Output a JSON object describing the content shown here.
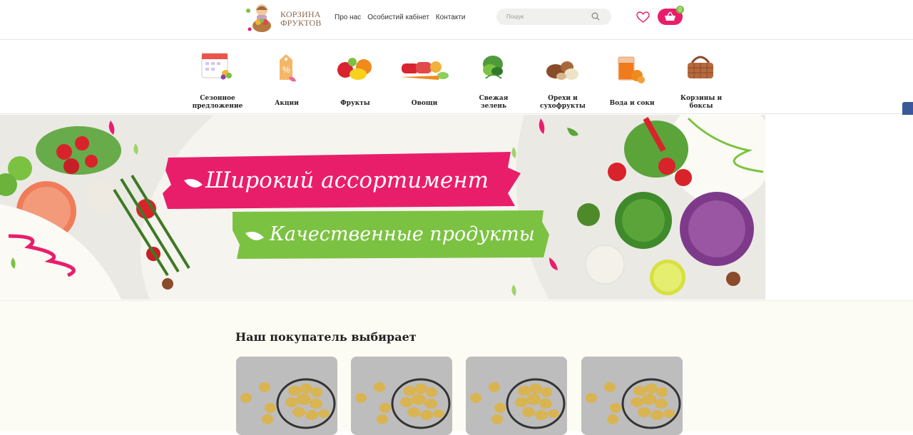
{
  "header": {
    "logo_line1": "КОРЗИНА",
    "logo_line2": "ФРУКТОВ",
    "nav": [
      "Про нас",
      "Особистий кабінет",
      "Контакти"
    ],
    "search_placeholder": "Пошук",
    "cart_count": "0"
  },
  "categories": [
    {
      "line1": "Сезонное",
      "line2": "предложение",
      "icon": "calendar-icon"
    },
    {
      "line1": "Акции",
      "line2": "",
      "icon": "discount-tag-icon"
    },
    {
      "line1": "Фрукты",
      "line2": "",
      "icon": "fruits-icon"
    },
    {
      "line1": "Овощи",
      "line2": "",
      "icon": "vegetables-icon"
    },
    {
      "line1": "Свежая",
      "line2": "зелень",
      "icon": "greens-icon"
    },
    {
      "line1": "Орехи и",
      "line2": "сухофрукты",
      "icon": "nuts-icon"
    },
    {
      "line1": "Вода и соки",
      "line2": "",
      "icon": "juice-icon"
    },
    {
      "line1": "Корзины и",
      "line2": "боксы",
      "icon": "basket-icon"
    }
  ],
  "banner": {
    "line1": "Широкий ассортимент",
    "line2": "Качественные продукты"
  },
  "section": {
    "title": "Наш покупатель выбирает"
  },
  "colors": {
    "accent_pink": "#e91e6b",
    "accent_green": "#7cc242"
  }
}
